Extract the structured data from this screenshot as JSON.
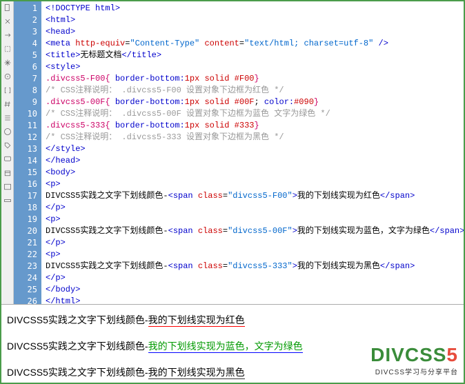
{
  "lines": [
    {
      "n": "1",
      "html": "<span class='tag'>&lt;!DOCTYPE html&gt;</span>"
    },
    {
      "n": "2",
      "html": "<span class='tag'>&lt;html&gt;</span>"
    },
    {
      "n": "3",
      "html": "<span class='tag'>&lt;head&gt;</span>"
    },
    {
      "n": "4",
      "html": "<span class='tag'>&lt;meta</span> <span class='attr'>http-equiv</span>=<span class='val'>\"Content-Type\"</span> <span class='attr'>content</span>=<span class='val'>\"text/html; charset=utf-8\"</span> <span class='tag'>/&gt;</span>"
    },
    {
      "n": "5",
      "html": "<span class='tag'>&lt;title&gt;</span><span class='txt'>无标题文档</span><span class='tag'>&lt;/title&gt;</span>"
    },
    {
      "n": "6",
      "html": "<span class='tag'>&lt;style&gt;</span>"
    },
    {
      "n": "7",
      "html": "<span class='sel-red'>.divcss5-F00</span><span class='brace'>{</span> <span class='prop'>border-bottom:</span><span class='pval-red'>1px solid #F00</span><span class='brace'>}</span>"
    },
    {
      "n": "8",
      "html": "<span class='comment'>/* CSS注释说明： .divcss5-F00 设置对象下边框为红色 */</span>"
    },
    {
      "n": "9",
      "html": "<span class='sel-red'>.divcss5-00F</span><span class='brace'>{</span> <span class='prop'>border-bottom:</span><span class='pval-red'>1px solid #00F</span><span class='txt'>;</span> <span class='prop'>color:</span><span class='pval-red'>#090</span><span class='brace'>}</span>"
    },
    {
      "n": "10",
      "html": "<span class='comment'>/* CSS注释说明： .divcss5-00F 设置对象下边框为蓝色 文字为绿色 */</span>"
    },
    {
      "n": "11",
      "html": "<span class='sel-red'>.divcss5-333</span><span class='brace'>{</span> <span class='prop'>border-bottom:</span><span class='pval-red'>1px solid #333</span><span class='brace'>}</span>"
    },
    {
      "n": "12",
      "html": "<span class='comment'>/* CSS注释说明： .divcss5-333 设置对象下边框为黑色 */</span>"
    },
    {
      "n": "13",
      "html": "<span class='tag'>&lt;/style&gt;</span>"
    },
    {
      "n": "14",
      "html": "<span class='tag'>&lt;/head&gt;</span>"
    },
    {
      "n": "15",
      "html": "<span class='tag'>&lt;body&gt;</span>"
    },
    {
      "n": "16",
      "html": "<span class='tag'>&lt;p&gt;</span>"
    },
    {
      "n": "17",
      "html": "<span class='txt'>DIVCSS5实践之文字下划线颜色-</span><span class='tag'>&lt;span</span> <span class='attr'>class</span>=<span class='val'>\"divcss5-F00\"</span><span class='tag'>&gt;</span><span class='txt'>我的下划线实现为红色</span><span class='tag'>&lt;/span&gt;</span>"
    },
    {
      "n": "18",
      "html": "<span class='tag'>&lt;/p&gt;</span>"
    },
    {
      "n": "19",
      "html": "<span class='tag'>&lt;p&gt;</span>"
    },
    {
      "n": "20",
      "html": "<span class='txt'>DIVCSS5实践之文字下划线颜色-</span><span class='tag'>&lt;span</span> <span class='attr'>class</span>=<span class='val'>\"divcss5-00F\"</span><span class='tag'>&gt;</span><span class='txt'>我的下划线实现为蓝色，文字为绿色</span><span class='tag'>&lt;/span&gt;</span>"
    },
    {
      "n": "21",
      "html": "<span class='tag'>&lt;/p&gt;</span>"
    },
    {
      "n": "22",
      "html": "<span class='tag'>&lt;p&gt;</span>"
    },
    {
      "n": "23",
      "html": "<span class='txt'>DIVCSS5实践之文字下划线颜色-</span><span class='tag'>&lt;span</span> <span class='attr'>class</span>=<span class='val'>\"divcss5-333\"</span><span class='tag'>&gt;</span><span class='txt'>我的下划线实现为黑色</span><span class='tag'>&lt;/span&gt;</span>"
    },
    {
      "n": "24",
      "html": "<span class='tag'>&lt;/p&gt;</span>"
    },
    {
      "n": "25",
      "html": "<span class='tag'>&lt;/body&gt;</span>"
    },
    {
      "n": "26",
      "html": "<span class='tag'>&lt;/html&gt;</span>"
    }
  ],
  "preview": {
    "p1_prefix": "DIVCSS5实践之文字下划线颜色-",
    "p1_span": "我的下划线实现为红色",
    "p2_prefix": "DIVCSS5实践之文字下划线颜色-",
    "p2_span": "我的下划线实现为蓝色，文字为绿色",
    "p3_prefix": "DIVCSS5实践之文字下划线颜色-",
    "p3_span": "我的下划线实现为黑色"
  },
  "logo": {
    "main": "DIVCSS",
    "five": "5",
    "sub": "DIVCSS学习与分享平台"
  }
}
